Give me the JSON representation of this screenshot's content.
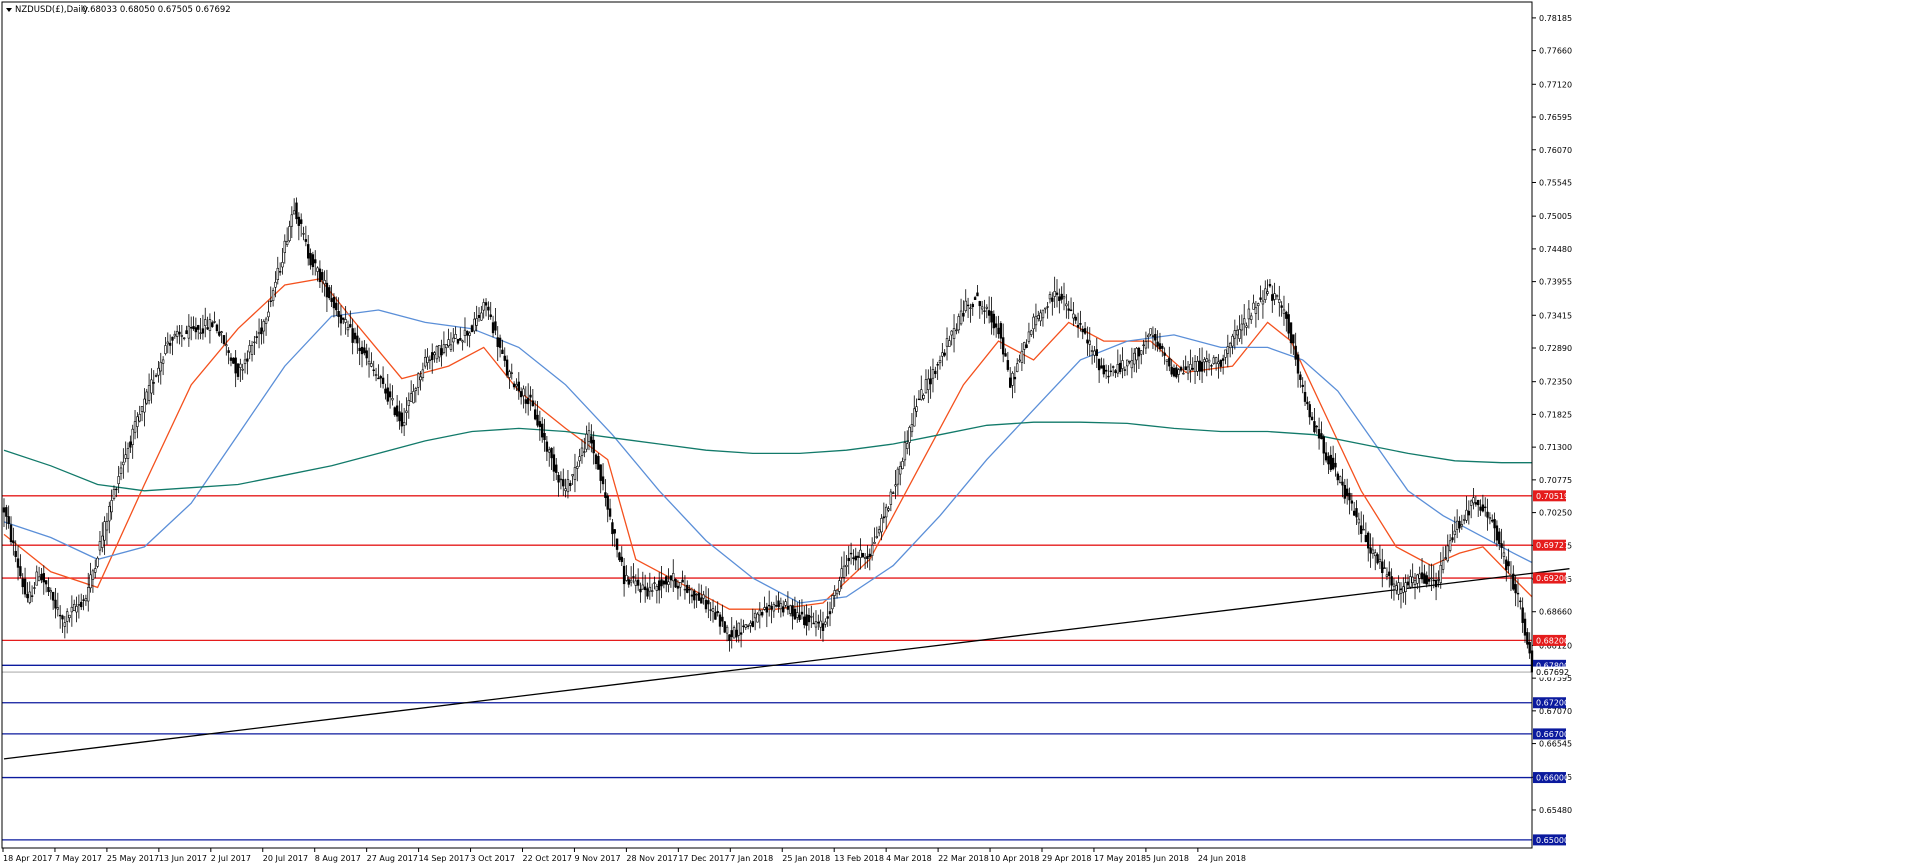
{
  "header": {
    "symbol_label": "NZDUSD(£),Daily",
    "ohlc_values": "0.68033 0.68050 0.67505 0.67692"
  },
  "colors": {
    "background": "#ffffff",
    "frame": "#000000",
    "candle": "#000000",
    "ma_fast": "#f4511e",
    "ma_mid": "#5b8fd8",
    "ma_slow": "#127a6a",
    "resistance": "#e51c1c",
    "support": "#0b1a9e",
    "trendline": "#000000",
    "label_text": "#ffffff"
  },
  "chart_data": {
    "type": "candlestick",
    "title": "NZDUSD(£),Daily",
    "ylim": [
      0.6487,
      0.7844
    ],
    "y_ticks": [
      "0.78185",
      "0.77660",
      "0.77120",
      "0.76595",
      "0.76070",
      "0.75545",
      "0.75005",
      "0.74480",
      "0.73955",
      "0.73415",
      "0.72890",
      "0.72350",
      "0.71825",
      "0.71300",
      "0.70775",
      "0.70250",
      "0.69725",
      "0.69185",
      "0.68660",
      "0.68120",
      "0.67595",
      "0.67070",
      "0.66545",
      "0.66005",
      "0.65480"
    ],
    "x_ticks": [
      "18 Apr 2017",
      "7 May 2017",
      "25 May 2017",
      "13 Jun 2017",
      "2 Jul 2017",
      "20 Jul 2017",
      "8 Aug 2017",
      "27 Aug 2017",
      "14 Sep 2017",
      "3 Oct 2017",
      "22 Oct 2017",
      "9 Nov 2017",
      "28 Nov 2017",
      "17 Dec 2017",
      "7 Jan 2018",
      "25 Jan 2018",
      "13 Feb 2018",
      "4 Mar 2018",
      "22 Mar 2018",
      "10 Apr 2018",
      "29 Apr 2018",
      "17 May 2018",
      "5 Jun 2018",
      "24 Jun 2018"
    ],
    "price_path": [
      [
        0,
        0.703
      ],
      [
        10,
        0.688
      ],
      [
        15,
        0.693
      ],
      [
        25,
        0.685
      ],
      [
        35,
        0.689
      ],
      [
        50,
        0.71
      ],
      [
        70,
        0.73
      ],
      [
        90,
        0.733
      ],
      [
        100,
        0.725
      ],
      [
        110,
        0.732
      ],
      [
        118,
        0.742
      ],
      [
        124,
        0.752
      ],
      [
        130,
        0.744
      ],
      [
        145,
        0.733
      ],
      [
        160,
        0.724
      ],
      [
        170,
        0.717
      ],
      [
        180,
        0.727
      ],
      [
        200,
        0.732
      ],
      [
        206,
        0.736
      ],
      [
        215,
        0.725
      ],
      [
        225,
        0.72
      ],
      [
        235,
        0.71
      ],
      [
        240,
        0.706
      ],
      [
        250,
        0.715
      ],
      [
        255,
        0.708
      ],
      [
        265,
        0.692
      ],
      [
        275,
        0.69
      ],
      [
        285,
        0.692
      ],
      [
        300,
        0.688
      ],
      [
        310,
        0.683
      ],
      [
        320,
        0.685
      ],
      [
        330,
        0.688
      ],
      [
        340,
        0.686
      ],
      [
        350,
        0.684
      ],
      [
        360,
        0.695
      ],
      [
        370,
        0.696
      ],
      [
        380,
        0.706
      ],
      [
        390,
        0.72
      ],
      [
        400,
        0.727
      ],
      [
        410,
        0.735
      ],
      [
        415,
        0.737
      ],
      [
        425,
        0.732
      ],
      [
        430,
        0.723
      ],
      [
        440,
        0.733
      ],
      [
        450,
        0.738
      ],
      [
        460,
        0.732
      ],
      [
        470,
        0.725
      ],
      [
        480,
        0.726
      ],
      [
        490,
        0.731
      ],
      [
        500,
        0.725
      ],
      [
        510,
        0.726
      ],
      [
        520,
        0.727
      ],
      [
        530,
        0.733
      ],
      [
        540,
        0.7385
      ],
      [
        548,
        0.734
      ],
      [
        556,
        0.72
      ],
      [
        565,
        0.712
      ],
      [
        575,
        0.704
      ],
      [
        585,
        0.696
      ],
      [
        595,
        0.69
      ],
      [
        605,
        0.692
      ],
      [
        612,
        0.691
      ],
      [
        620,
        0.7
      ],
      [
        628,
        0.704
      ],
      [
        635,
        0.702
      ],
      [
        642,
        0.694
      ],
      [
        648,
        0.688
      ],
      [
        651,
        0.681
      ],
      [
        653,
        0.6769
      ]
    ],
    "series": [
      {
        "name": "",
        "color_key": "ma_fast",
        "points": [
          [
            0,
            0.699
          ],
          [
            20,
            0.693
          ],
          [
            40,
            0.6905
          ],
          [
            60,
            0.707
          ],
          [
            80,
            0.723
          ],
          [
            100,
            0.732
          ],
          [
            120,
            0.739
          ],
          [
            135,
            0.74
          ],
          [
            150,
            0.733
          ],
          [
            170,
            0.724
          ],
          [
            190,
            0.726
          ],
          [
            205,
            0.729
          ],
          [
            220,
            0.722
          ],
          [
            240,
            0.716
          ],
          [
            258,
            0.711
          ],
          [
            270,
            0.695
          ],
          [
            290,
            0.691
          ],
          [
            310,
            0.687
          ],
          [
            330,
            0.687
          ],
          [
            350,
            0.688
          ],
          [
            370,
            0.695
          ],
          [
            390,
            0.709
          ],
          [
            410,
            0.723
          ],
          [
            425,
            0.73
          ],
          [
            440,
            0.727
          ],
          [
            455,
            0.733
          ],
          [
            470,
            0.73
          ],
          [
            490,
            0.73
          ],
          [
            505,
            0.725
          ],
          [
            525,
            0.726
          ],
          [
            540,
            0.733
          ],
          [
            550,
            0.73
          ],
          [
            565,
            0.718
          ],
          [
            580,
            0.706
          ],
          [
            595,
            0.697
          ],
          [
            610,
            0.694
          ],
          [
            622,
            0.696
          ],
          [
            632,
            0.697
          ],
          [
            645,
            0.692
          ],
          [
            653,
            0.689
          ]
        ]
      },
      {
        "name": "",
        "color_key": "ma_mid",
        "points": [
          [
            0,
            0.701
          ],
          [
            20,
            0.6985
          ],
          [
            40,
            0.695
          ],
          [
            60,
            0.697
          ],
          [
            80,
            0.704
          ],
          [
            100,
            0.715
          ],
          [
            120,
            0.726
          ],
          [
            140,
            0.734
          ],
          [
            160,
            0.735
          ],
          [
            180,
            0.733
          ],
          [
            200,
            0.732
          ],
          [
            220,
            0.729
          ],
          [
            240,
            0.723
          ],
          [
            260,
            0.715
          ],
          [
            280,
            0.706
          ],
          [
            300,
            0.698
          ],
          [
            320,
            0.692
          ],
          [
            340,
            0.688
          ],
          [
            360,
            0.689
          ],
          [
            380,
            0.694
          ],
          [
            400,
            0.702
          ],
          [
            420,
            0.711
          ],
          [
            440,
            0.719
          ],
          [
            460,
            0.727
          ],
          [
            480,
            0.73
          ],
          [
            500,
            0.731
          ],
          [
            520,
            0.729
          ],
          [
            540,
            0.729
          ],
          [
            555,
            0.727
          ],
          [
            570,
            0.722
          ],
          [
            585,
            0.714
          ],
          [
            600,
            0.706
          ],
          [
            615,
            0.702
          ],
          [
            630,
            0.699
          ],
          [
            645,
            0.696
          ],
          [
            653,
            0.6945
          ]
        ]
      },
      {
        "name": "",
        "color_key": "ma_slow",
        "points": [
          [
            0,
            0.7125
          ],
          [
            20,
            0.71
          ],
          [
            40,
            0.707
          ],
          [
            60,
            0.706
          ],
          [
            80,
            0.7065
          ],
          [
            100,
            0.707
          ],
          [
            120,
            0.7085
          ],
          [
            140,
            0.71
          ],
          [
            160,
            0.712
          ],
          [
            180,
            0.714
          ],
          [
            200,
            0.7155
          ],
          [
            220,
            0.716
          ],
          [
            240,
            0.7155
          ],
          [
            260,
            0.7145
          ],
          [
            280,
            0.7135
          ],
          [
            300,
            0.7125
          ],
          [
            320,
            0.712
          ],
          [
            340,
            0.712
          ],
          [
            360,
            0.7125
          ],
          [
            380,
            0.7135
          ],
          [
            400,
            0.715
          ],
          [
            420,
            0.7165
          ],
          [
            440,
            0.717
          ],
          [
            460,
            0.717
          ],
          [
            480,
            0.7168
          ],
          [
            500,
            0.716
          ],
          [
            520,
            0.7155
          ],
          [
            540,
            0.7155
          ],
          [
            560,
            0.715
          ],
          [
            580,
            0.7135
          ],
          [
            600,
            0.712
          ],
          [
            620,
            0.7108
          ],
          [
            640,
            0.7105
          ],
          [
            653,
            0.7105
          ]
        ]
      }
    ],
    "horizontal_levels": [
      {
        "value": 0.70519,
        "label": "0.70519",
        "color_key": "resistance"
      },
      {
        "value": 0.69727,
        "label": "0.69727",
        "color_key": "resistance"
      },
      {
        "value": 0.692,
        "label": "0.69200",
        "color_key": "resistance"
      },
      {
        "value": 0.682,
        "label": "0.68200",
        "color_key": "resistance"
      },
      {
        "value": 0.678,
        "label": "0.67800",
        "color_key": "support"
      },
      {
        "value": 0.672,
        "label": "0.67200",
        "color_key": "support"
      },
      {
        "value": 0.667,
        "label": "0.66700",
        "color_key": "support"
      },
      {
        "value": 0.66,
        "label": "0.66000",
        "color_key": "support"
      },
      {
        "value": 0.65,
        "label": "0.65000",
        "color_key": "support"
      }
    ],
    "current_price": {
      "value": 0.67692,
      "label": "0.67692"
    },
    "trendline": {
      "start": [
        0,
        0.663
      ],
      "end": [
        669,
        0.6935
      ]
    },
    "grid": false,
    "legend": "none"
  }
}
